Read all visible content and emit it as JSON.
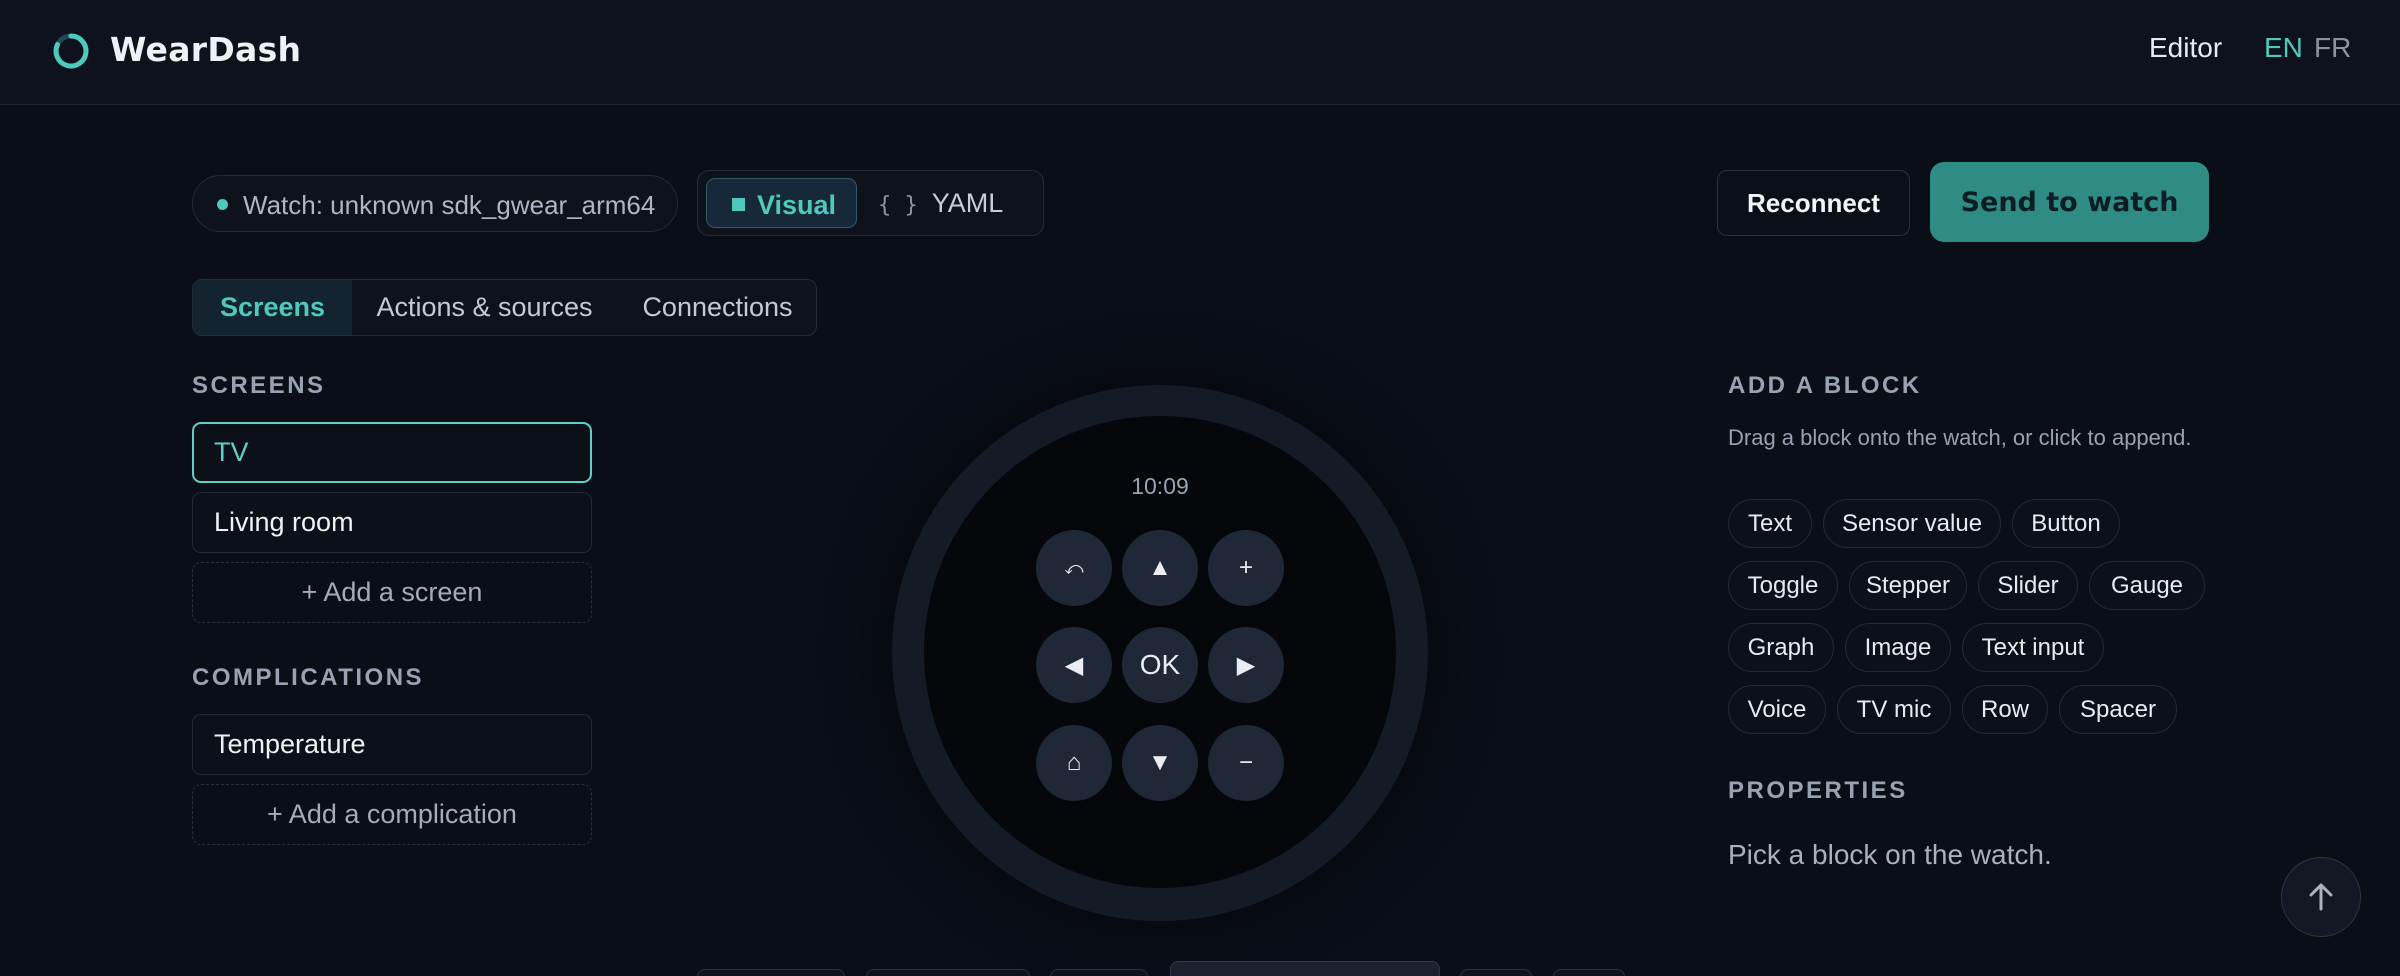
{
  "header": {
    "brand": "WearDash",
    "nav_editor": "Editor",
    "lang_en": "EN",
    "lang_fr": "FR",
    "accent_color": "#4fc9bd"
  },
  "toolbar": {
    "watch_status": "Watch: unknown sdk_gwear_arm64",
    "mode_visual": "Visual",
    "mode_yaml_icon": "{ }",
    "mode_yaml": "YAML",
    "reconnect": "Reconnect",
    "send": "Send to watch"
  },
  "tabs": {
    "screens": "Screens",
    "actions": "Actions & sources",
    "connections": "Connections"
  },
  "screens": {
    "title": "SCREENS",
    "items": [
      "TV",
      "Living room"
    ],
    "add": "+ Add a screen"
  },
  "complications": {
    "title": "COMPLICATIONS",
    "items": [
      "Temperature"
    ],
    "add": "+ Add a complication"
  },
  "watch": {
    "time": "10:09",
    "buttons": {
      "back": "⤺",
      "up": "▲",
      "plus": "+",
      "left": "◀",
      "ok": "OK",
      "right": "▶",
      "home": "⌂",
      "down": "▼",
      "minus": "−"
    }
  },
  "add_block": {
    "title": "ADD A BLOCK",
    "hint": "Drag a block onto the watch, or click to append.",
    "chips": [
      "Text",
      "Sensor value",
      "Button",
      "Toggle",
      "Stepper",
      "Slider",
      "Gauge",
      "Graph",
      "Image",
      "Text input",
      "Voice",
      "TV mic",
      "Row",
      "Spacer"
    ]
  },
  "properties": {
    "title": "PROPERTIES",
    "empty": "Pick a block on the watch."
  }
}
